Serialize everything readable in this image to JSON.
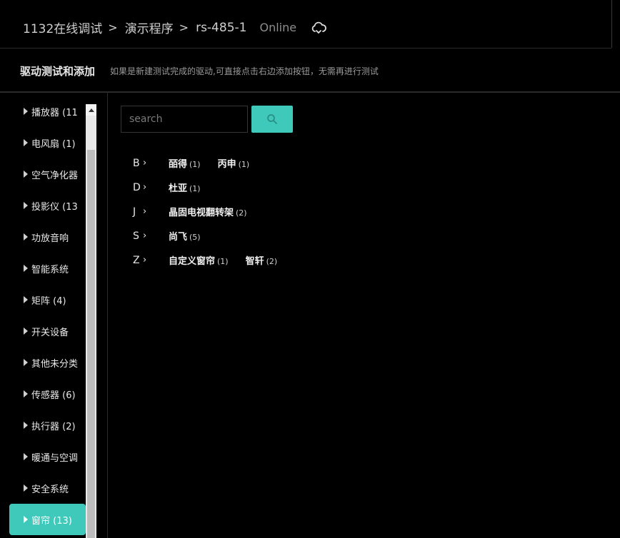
{
  "breadcrumb": [
    "1132在线调试",
    "演示程序",
    "rs-485-1"
  ],
  "status": "Online",
  "cloud_icon": "cloud-sync-icon",
  "subheader": {
    "title": "驱动测试和添加",
    "note": "如果是新建测试完成的驱动,可直接点击右边添加按钮，无需再进行测试"
  },
  "sidebar": {
    "categories": [
      {
        "label": "播放器 (11"
      },
      {
        "label": "电风扇 (1)"
      },
      {
        "label": "空气净化器"
      },
      {
        "label": "投影仪 (13"
      },
      {
        "label": "功放音响"
      },
      {
        "label": "智能系统"
      },
      {
        "label": "矩阵 (4)"
      },
      {
        "label": "开关设备"
      },
      {
        "label": "其他未分类"
      },
      {
        "label": "传感器 (6)"
      },
      {
        "label": "执行器 (2)"
      },
      {
        "label": "暖通与空调"
      },
      {
        "label": "安全系统"
      },
      {
        "label": "窗帘 (13)"
      }
    ],
    "active_index": 13
  },
  "search": {
    "placeholder": "search",
    "button_icon": "search-icon"
  },
  "brand_groups": [
    {
      "letter": "B",
      "chevron": "›",
      "brands": [
        {
          "name": "皕得",
          "count": "(1)"
        },
        {
          "name": "丙申",
          "count": "(1)"
        }
      ]
    },
    {
      "letter": "D",
      "chevron": "›",
      "brands": [
        {
          "name": "杜亚",
          "count": "(1)"
        }
      ]
    },
    {
      "letter": "J",
      "chevron": "›",
      "brands": [
        {
          "name": "晶固电视翻转架",
          "count": "(2)"
        }
      ]
    },
    {
      "letter": "S",
      "chevron": "›",
      "brands": [
        {
          "name": "尚飞",
          "count": "(5)"
        }
      ]
    },
    {
      "letter": "Z",
      "chevron": "›",
      "brands": [
        {
          "name": "自定义窗帘",
          "count": "(1)"
        },
        {
          "name": "智轩",
          "count": "(2)"
        }
      ]
    }
  ],
  "colors": {
    "accent": "#3fc9bb",
    "background": "#000000"
  }
}
